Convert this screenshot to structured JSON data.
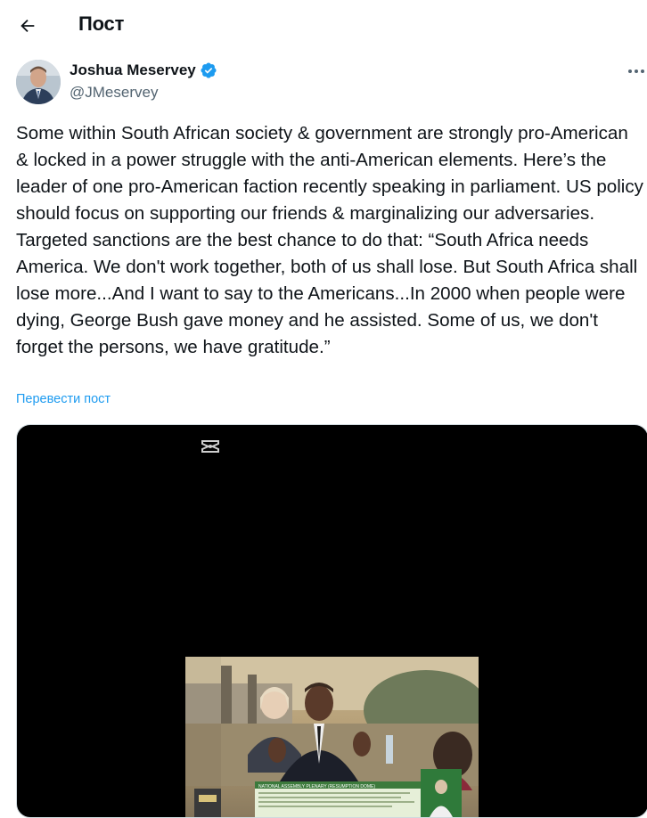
{
  "header": {
    "title": "Пост",
    "back_icon": "arrow-left-icon"
  },
  "author": {
    "name": "Joshua Meservey",
    "handle": "@JMeservey",
    "verified": true,
    "verified_color": "#1d9bf0"
  },
  "post": {
    "text": "Some within South African society & government are strongly pro-American & locked in a power struggle with the anti-American elements. Here’s the leader of one pro-American faction recently speaking in parliament. US policy should focus on supporting our friends & marginalizing our adversaries. Targeted sanctions are the best chance to do that: “South Africa needs America. We don't work together, both of us shall lose. But South Africa shall lose more...And I want to say to the Americans...In 2000 when people were dying, George Bush gave money and he assisted. Some of us, we don't forget the persons, we have gratitude.”",
    "translate_label": "Перевести пост"
  },
  "media": {
    "type": "video",
    "watermark_icon": "capcut-icon",
    "caption_banner": "NATIONAL ASSEMBLY PLENARY (RESUMPTION DOME)"
  },
  "colors": {
    "text": "#0f1419",
    "secondary": "#536471",
    "link": "#1d9bf0"
  }
}
